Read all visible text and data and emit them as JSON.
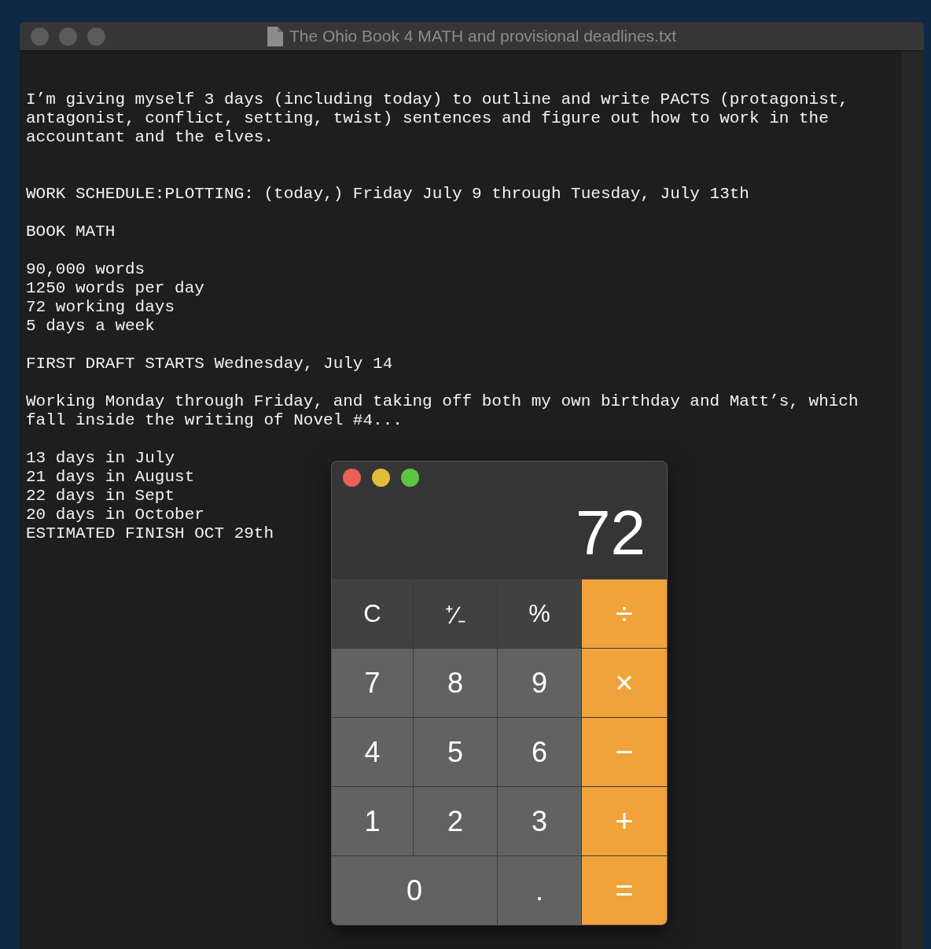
{
  "editor": {
    "title": "The Ohio Book 4 MATH and provisional deadlines.txt",
    "paragraphs": [
      {
        "lines": [
          "I’m giving myself 3 days (including today) to outline and write PACTS (protagonist,",
          "antagonist, conflict, setting, twist) sentences and figure out how to work in the",
          "accountant and the elves."
        ]
      },
      {
        "lines": [
          "WORK SCHEDULE:PLOTTING: (today,) Friday July 9 through Tuesday, July 13th"
        ]
      },
      {
        "lines": [
          "BOOK MATH"
        ]
      },
      {
        "lines": [
          "90,000 words",
          "1250 words per day",
          "72 working days",
          "5 days a week"
        ]
      },
      {
        "lines": [
          "FIRST DRAFT STARTS Wednesday, July 14"
        ]
      },
      {
        "lines": [
          "Working Monday through Friday, and taking off both my own birthday and Matt’s, which",
          "fall inside the writing of Novel #4..."
        ]
      },
      {
        "lines": [
          "13 days in July",
          "21 days in August",
          "22 days in Sept",
          "20 days in October",
          "ESTIMATED FINISH OCT 29th"
        ]
      }
    ]
  },
  "calculator": {
    "display": "72",
    "keys": [
      {
        "label": "C",
        "kind": "function"
      },
      {
        "label": "⁺∕₋",
        "kind": "function"
      },
      {
        "label": "%",
        "kind": "function"
      },
      {
        "label": "÷",
        "kind": "operator"
      },
      {
        "label": "7",
        "kind": "digit"
      },
      {
        "label": "8",
        "kind": "digit"
      },
      {
        "label": "9",
        "kind": "digit"
      },
      {
        "label": "×",
        "kind": "operator"
      },
      {
        "label": "4",
        "kind": "digit"
      },
      {
        "label": "5",
        "kind": "digit"
      },
      {
        "label": "6",
        "kind": "digit"
      },
      {
        "label": "−",
        "kind": "operator"
      },
      {
        "label": "1",
        "kind": "digit"
      },
      {
        "label": "2",
        "kind": "digit"
      },
      {
        "label": "3",
        "kind": "digit"
      },
      {
        "label": "+",
        "kind": "operator"
      },
      {
        "label": "0",
        "kind": "wide-digit"
      },
      {
        "label": ".",
        "kind": "digit"
      },
      {
        "label": "=",
        "kind": "operator"
      }
    ]
  }
}
